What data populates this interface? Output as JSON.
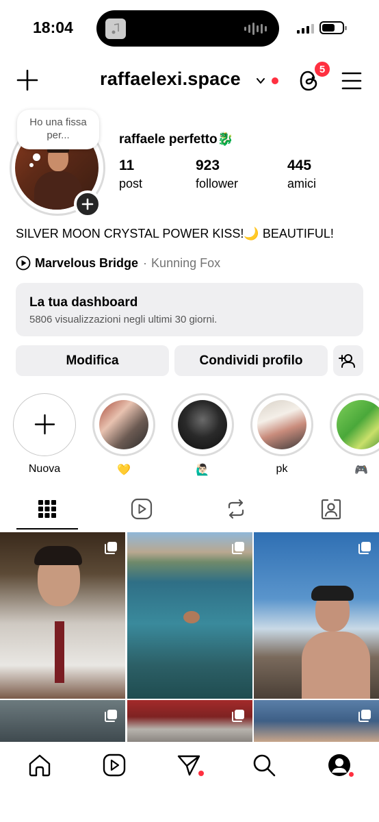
{
  "status_bar": {
    "time": "18:04"
  },
  "header": {
    "username": "raffaelexi.space",
    "threads_badge": "5"
  },
  "profile": {
    "note": "Ho una fissa per...",
    "name": "raffaele perfetto🐉",
    "stats": [
      {
        "value": "11",
        "label": "post"
      },
      {
        "value": "923",
        "label": "follower"
      },
      {
        "value": "445",
        "label": "amici"
      }
    ],
    "bio": "SILVER MOON CRYSTAL POWER KISS!🌙 BEAUTIFUL!",
    "music": {
      "song": "Marvelous Bridge",
      "separator": "·",
      "artist": "Kunning Fox"
    }
  },
  "dashboard": {
    "title": "La tua dashboard",
    "subtitle": "5806 visualizzazioni negli ultimi 30 giorni."
  },
  "actions": {
    "edit": "Modifica",
    "share": "Condividi profilo"
  },
  "highlights": [
    {
      "label": "Nuova"
    },
    {
      "label": "💛"
    },
    {
      "label": "🙋🏻‍♂️"
    },
    {
      "label": "pk"
    },
    {
      "label": "🎮"
    }
  ],
  "colors": {
    "notification": "#ff3040",
    "button_bg": "#efeff1",
    "ring": "#dbdbdb"
  }
}
